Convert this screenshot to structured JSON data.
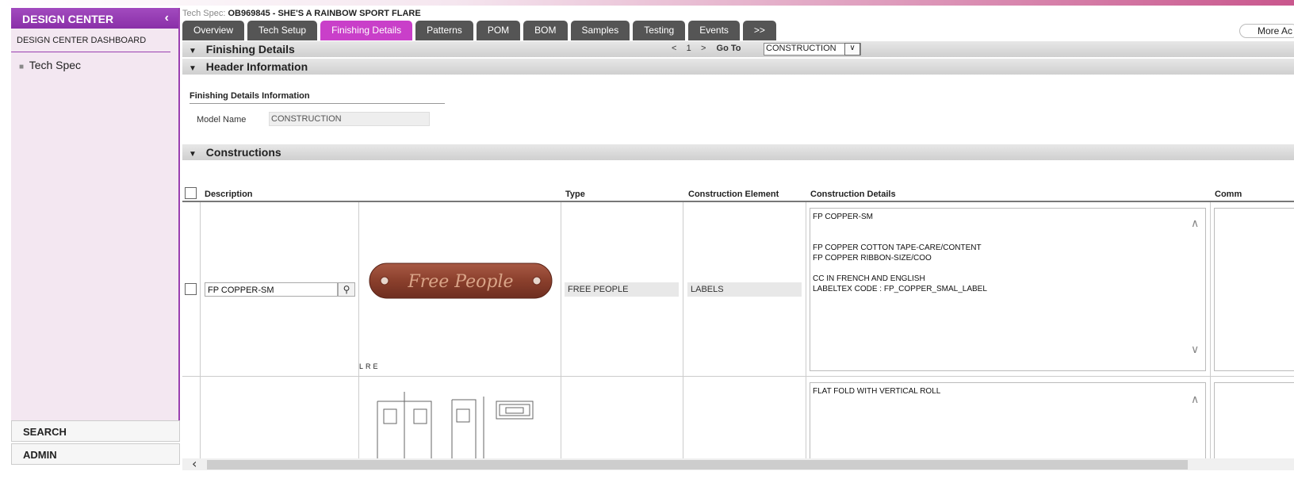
{
  "sidebar": {
    "title": "DESIGN CENTER",
    "dashboard": "DESIGN CENTER DASHBOARD",
    "items": [
      {
        "label": "Tech Spec"
      }
    ],
    "bottom": [
      {
        "label": "SEARCH"
      },
      {
        "label": "ADMIN"
      }
    ]
  },
  "header": {
    "spec_label": "Tech Spec:",
    "spec_value": "OB969845 - SHE'S A RAINBOW SPORT FLARE",
    "more_actions": "More Ac"
  },
  "tabs": [
    {
      "label": "Overview"
    },
    {
      "label": "Tech Setup"
    },
    {
      "label": "Finishing Details",
      "active": true
    },
    {
      "label": "Patterns"
    },
    {
      "label": "POM"
    },
    {
      "label": "BOM"
    },
    {
      "label": "Samples"
    },
    {
      "label": "Testing"
    },
    {
      "label": "Events"
    },
    {
      "label": ">>"
    }
  ],
  "sections": {
    "finishing": "Finishing Details",
    "header_info": "Header Information",
    "constructions": "Constructions"
  },
  "pager": {
    "prev": "<",
    "page": "1",
    "next": ">",
    "goto_label": "Go To",
    "goto_value": "CONSTRUCTION"
  },
  "finishing_info": {
    "title": "Finishing Details Information",
    "model_name_label": "Model Name",
    "model_name_value": "CONSTRUCTION"
  },
  "table": {
    "columns": [
      "Description",
      "Type",
      "Construction Element",
      "Construction Details",
      "Comm"
    ],
    "rows": [
      {
        "description": "FP COPPER-SM",
        "image_text": "Free People",
        "image_caption": "LRE",
        "type": "FREE PEOPLE",
        "element": "LABELS",
        "details": "FP COPPER-SM\n\n\nFP COPPER COTTON TAPE-CARE/CONTENT\nFP COPPER RIBBON-SIZE/COO\n\nCC IN FRENCH AND ENGLISH\nLABELTEX CODE : FP_COPPER_SMAL_LABEL"
      },
      {
        "description": "",
        "type": "",
        "element": "",
        "details": "FLAT FOLD WITH VERTICAL ROLL"
      }
    ]
  },
  "colors": {
    "accent": "#c93fc9",
    "sidebar_bg": "#f3e7f1",
    "tab_bg": "#555555"
  }
}
